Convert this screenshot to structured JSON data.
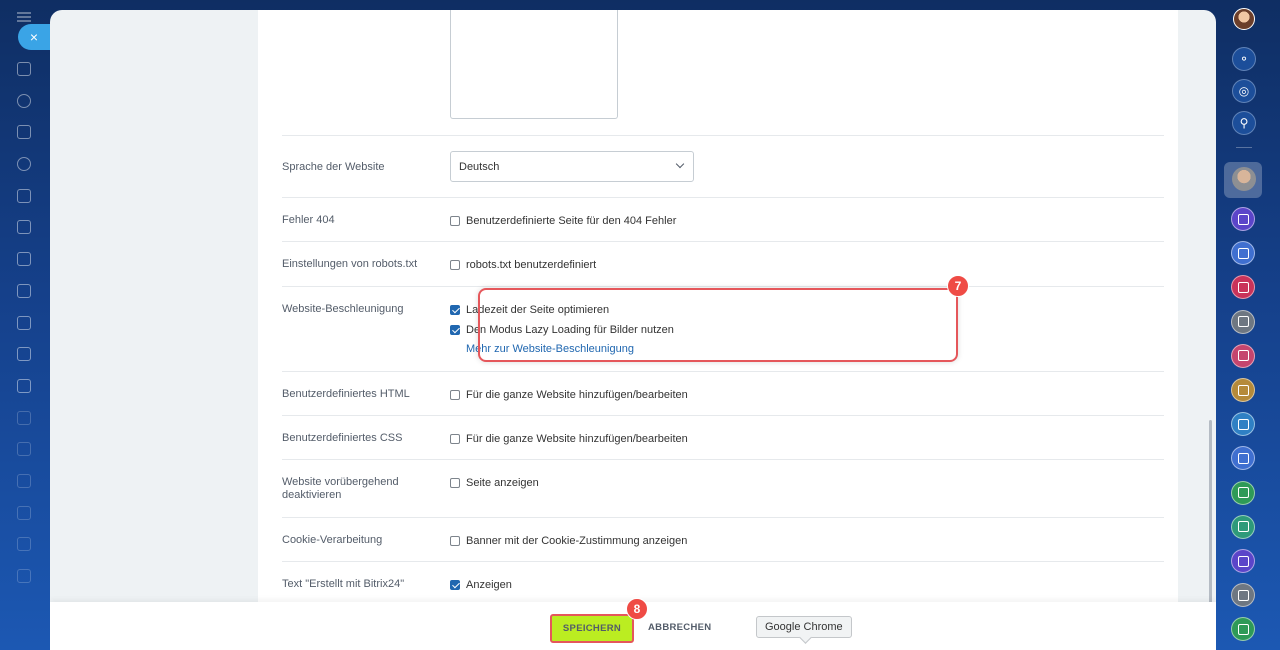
{
  "left_sidebar": {
    "close_label": "×",
    "icons": [
      "home-icon",
      "puzzle-icon",
      "document-icon",
      "users-icon",
      "inbox-icon",
      "file-icon",
      "chat-icon",
      "tasks-icon",
      "copy-icon",
      "mail-icon",
      "calendar-icon",
      "sign-icon",
      "drive-icon",
      "contact-center-icon",
      "filter-icon",
      "analytics-icon",
      "cart-icon"
    ]
  },
  "settings": {
    "language": {
      "label": "Sprache der Website",
      "selected": "Deutsch"
    },
    "error404": {
      "label": "Fehler 404",
      "option": "Benutzerdefinierte Seite für den 404 Fehler",
      "checked": false
    },
    "robots": {
      "label": "Einstellungen von robots.txt",
      "option": "robots.txt benutzerdefiniert",
      "checked": false
    },
    "acceleration": {
      "label": "Website-Beschleunigung",
      "option1": "Ladezeit der Seite optimieren",
      "option2": "Den Modus Lazy Loading für Bilder nutzen",
      "link": "Mehr zur Website-Beschleunigung",
      "badge": "7"
    },
    "custom_html": {
      "label": "Benutzerdefiniertes HTML",
      "option": "Für die ganze Website hinzufügen/bearbeiten",
      "checked": false
    },
    "custom_css": {
      "label": "Benutzerdefiniertes CSS",
      "option": "Für die ganze Website hinzufügen/bearbeiten",
      "checked": false
    },
    "deactivate": {
      "label": "Website vorübergehend deaktivieren",
      "option": "Seite anzeigen",
      "checked": false
    },
    "cookie": {
      "label": "Cookie-Verarbeitung",
      "option": "Banner mit der Cookie-Zustimmung anzeigen",
      "checked": false
    },
    "made_with": {
      "label": "Text \"Erstellt mit Bitrix24\"",
      "option": "Anzeigen",
      "checked": true
    }
  },
  "footer": {
    "save_label": "SPEICHERN",
    "cancel_label": "ABBRECHEN",
    "save_badge": "8",
    "tooltip": "Google Chrome"
  },
  "right_sidebar": {
    "icons": [
      "bell-icon",
      "target-icon",
      "search-icon"
    ],
    "task_colors": [
      "#5b45c9",
      "#3f6fd0",
      "#c9335a",
      "#6e7782",
      "#c5456e",
      "#b58a3a",
      "#2f80c4",
      "#3f6fd0",
      "#2e9a57",
      "#2e9a7a",
      "#5b45c9",
      "#6e7782",
      "#2e9a57"
    ]
  }
}
